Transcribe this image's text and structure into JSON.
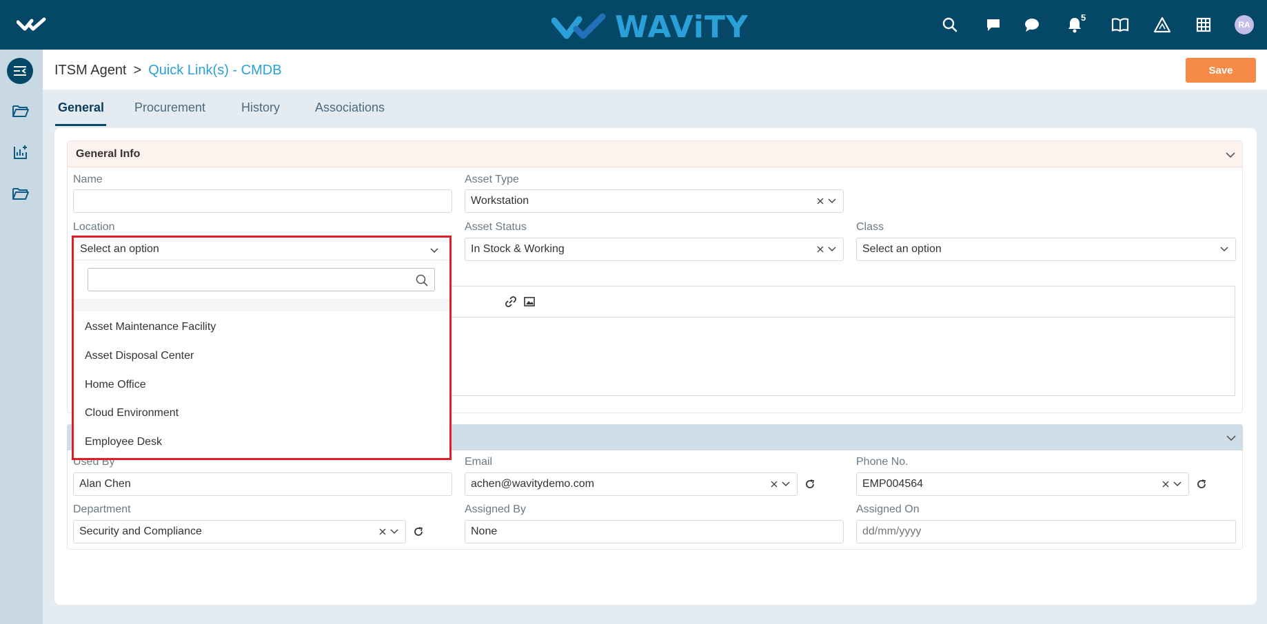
{
  "app": {
    "brand": "WAViTY",
    "notifications_count": "5",
    "avatar_initials": "RA"
  },
  "header": {
    "breadcrumb_root": "ITSM Agent",
    "breadcrumb_sep": ">",
    "breadcrumb_current": "Quick Link(s) - CMDB",
    "save_label": "Save"
  },
  "tabs": [
    {
      "label": "General",
      "active": true
    },
    {
      "label": "Procurement",
      "active": false
    },
    {
      "label": "History",
      "active": false
    },
    {
      "label": "Associations",
      "active": false
    }
  ],
  "general_info": {
    "title": "General Info",
    "name_label": "Name",
    "name_value": "",
    "asset_type_label": "Asset Type",
    "asset_type_value": "Workstation",
    "location_label": "Location",
    "location_value": "Select an option",
    "asset_status_label": "Asset Status",
    "asset_status_value": "In Stock & Working",
    "class_label": "Class",
    "class_value": "Select an option"
  },
  "location_dropdown": {
    "search_value": "",
    "options": [
      "Asset Maintenance Facility",
      "Asset Disposal Center",
      "Home Office",
      "Cloud Environment",
      "Employee Desk"
    ]
  },
  "usage": {
    "used_by_label": "Used By",
    "used_by_value": "Alan Chen",
    "email_label": "Email",
    "email_value": "achen@wavitydemo.com",
    "phone_label": "Phone No.",
    "phone_value": "EMP004564",
    "department_label": "Department",
    "department_value": "Security and Compliance",
    "assigned_by_label": "Assigned By",
    "assigned_by_value": "None",
    "assigned_on_label": "Assigned On",
    "assigned_on_placeholder": "dd/mm/yyyy"
  },
  "colors": {
    "topbar": "#044767",
    "brand": "#2a9fd8",
    "accent_save": "#f58b47",
    "highlight_border": "#e31b23"
  }
}
